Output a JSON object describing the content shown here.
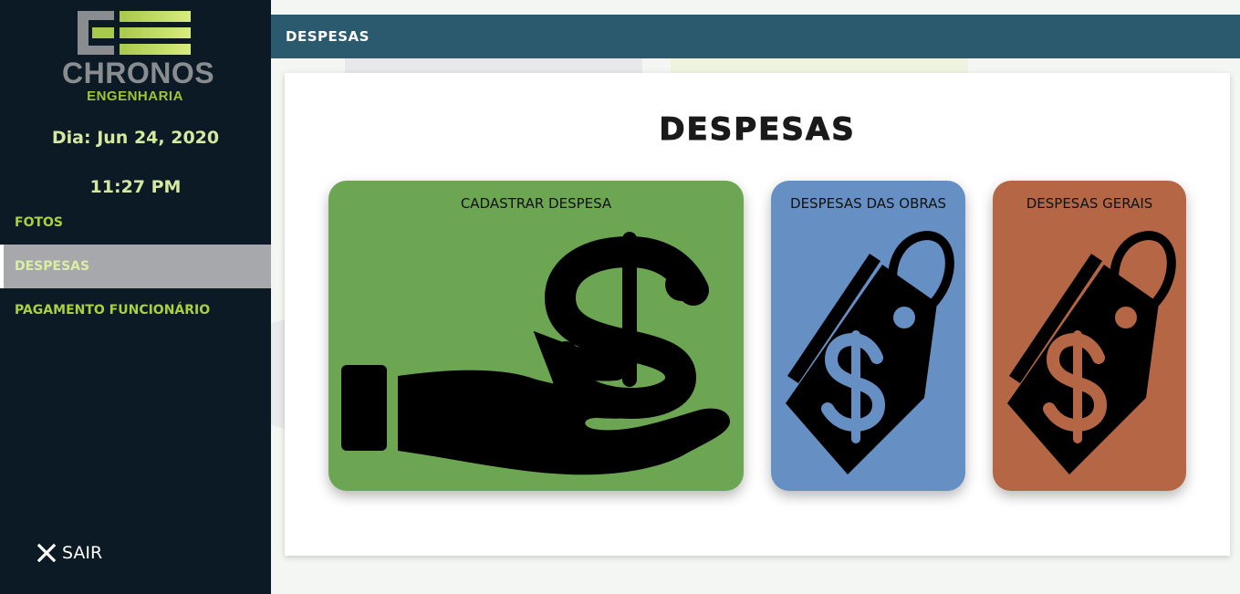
{
  "sidebar": {
    "logo": {
      "name": "CHRONOS",
      "subtitle": "ENGENHARIA"
    },
    "date": "Dia: Jun 24, 2020",
    "time": "11:27 PM",
    "items": [
      {
        "label": "FOTOS",
        "active": false
      },
      {
        "label": "DESPESAS",
        "active": true
      },
      {
        "label": "PAGAMENTO FUNCIONÁRIO",
        "active": false
      }
    ],
    "logout": {
      "label": "SAIR",
      "icon": "close-icon"
    }
  },
  "topbar": {
    "title": "DESPESAS"
  },
  "main": {
    "heading": "DESPESAS",
    "tiles": [
      {
        "label": "CADASTRAR DESPESA",
        "icon": "hand-dollar-icon",
        "color": "#6ca653"
      },
      {
        "label": "DESPESAS DAS OBRAS",
        "icon": "price-tag-dollar-icon",
        "color": "#668fc4"
      },
      {
        "label": "DESPESAS GERAIS",
        "icon": "price-tag-dollar-icon",
        "color": "#b56745"
      }
    ]
  },
  "colors": {
    "sidebar_bg": "#0b1a24",
    "topbar_bg": "#2b5a6e",
    "accent_green": "#a8d13c",
    "active_item_bg": "#a6a8ab"
  }
}
